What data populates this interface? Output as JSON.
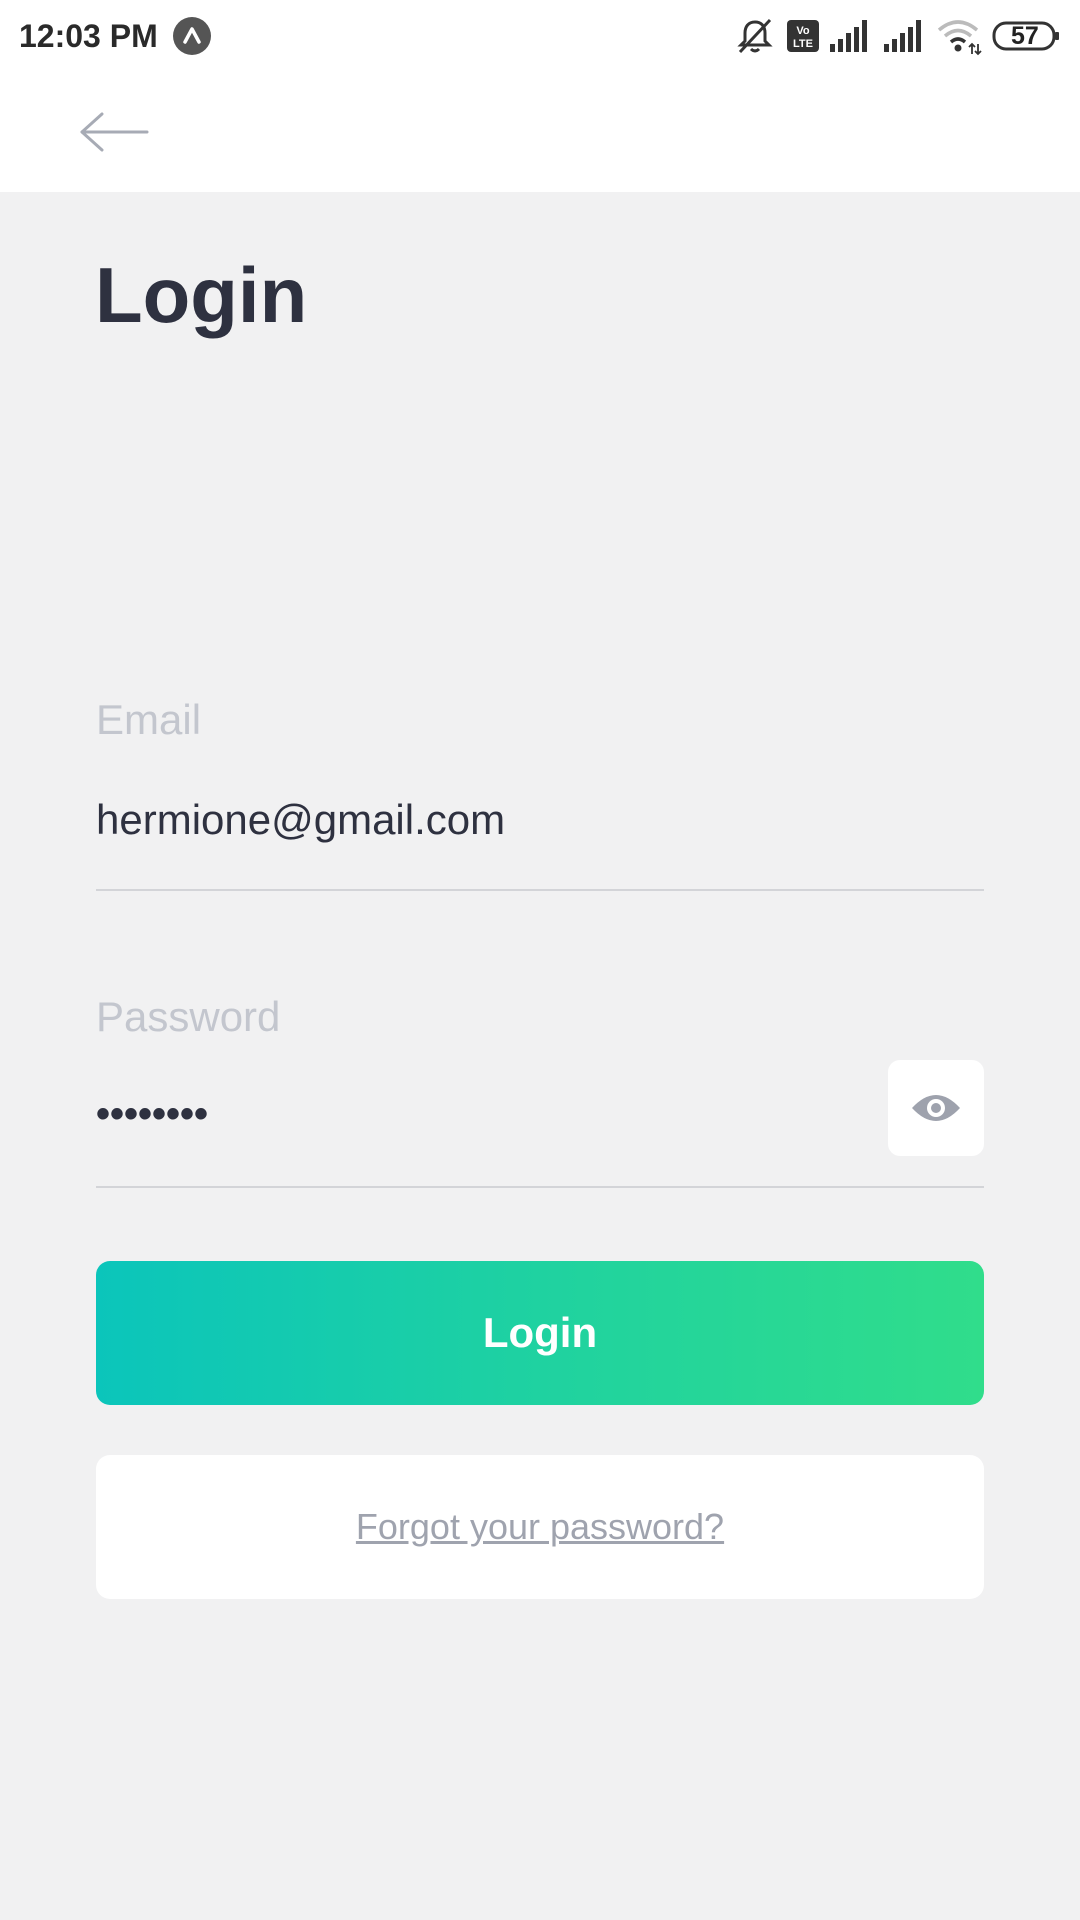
{
  "status_bar": {
    "time": "12:03 PM",
    "battery": "57",
    "app_icon": "arrow-up-circle-icon",
    "icons": [
      "silent-icon",
      "volte-icon",
      "signal-icon",
      "signal-icon",
      "wifi-icon",
      "battery-icon"
    ]
  },
  "header": {
    "back_icon": "arrow-left-icon"
  },
  "page": {
    "title": "Login"
  },
  "email": {
    "label": "Email",
    "value": "hermione@gmail.com"
  },
  "password": {
    "label": "Password",
    "value": "••••••••",
    "toggle_icon": "eye-icon"
  },
  "actions": {
    "login_label": "Login",
    "forgot_label": "Forgot your password?"
  },
  "colors": {
    "background": "#f1f1f2",
    "title": "#2e3140",
    "label": "#c3c6ce",
    "gradient_start": "#0bc5bb",
    "gradient_end": "#30dd8b",
    "link": "#9fa3ae"
  }
}
